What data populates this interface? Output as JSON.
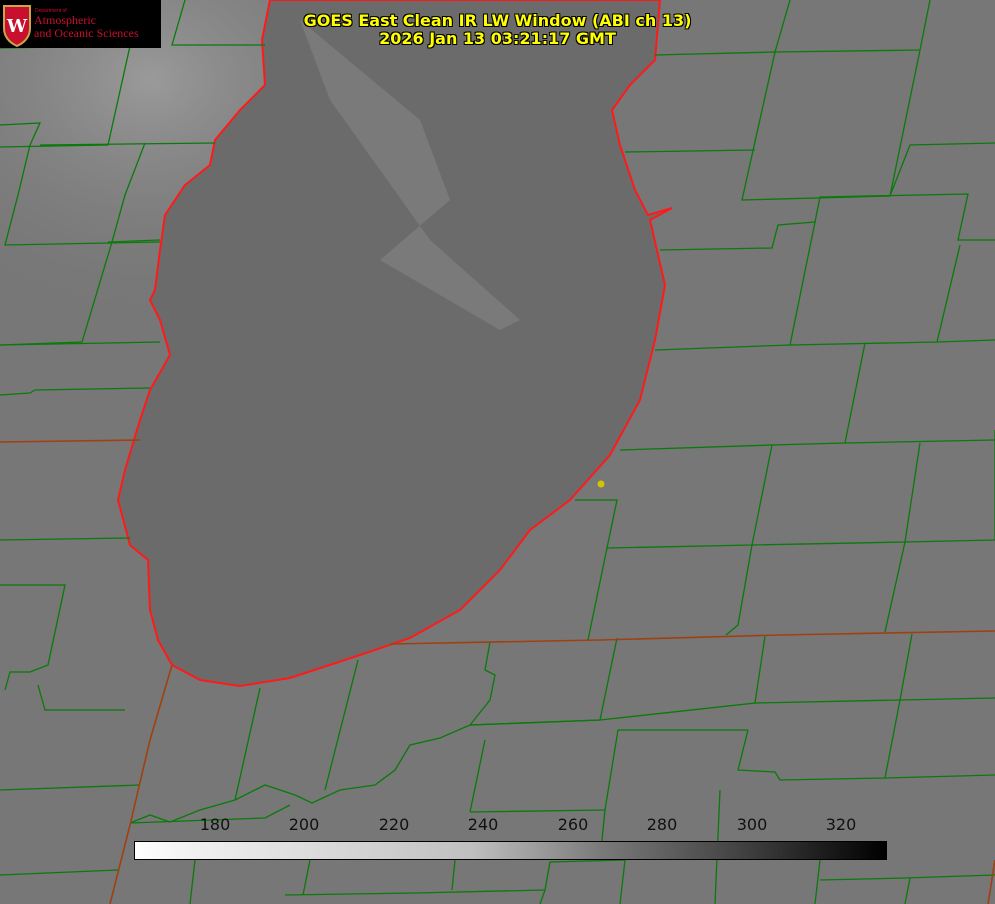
{
  "title": {
    "line1": "GOES East Clean IR LW Window (ABI ch 13)",
    "line2": "2026 Jan 13 03:21:17 GMT"
  },
  "logo": {
    "small": "Department of",
    "line1": "Atmospheric",
    "line2": "and Oceanic Sciences",
    "crest": "W"
  },
  "colorbar": {
    "range": [
      162,
      330
    ],
    "ticks": [
      "180",
      "200",
      "220",
      "240",
      "260",
      "280",
      "300",
      "320"
    ],
    "tick_values": [
      180,
      200,
      220,
      240,
      260,
      280,
      300,
      320
    ]
  },
  "colors": {
    "title": "#ffff00",
    "county_lines": "#0a7a0a",
    "coastline": "#ff1a1a",
    "state_lines": "#a04010",
    "marker": "#d4c400"
  }
}
